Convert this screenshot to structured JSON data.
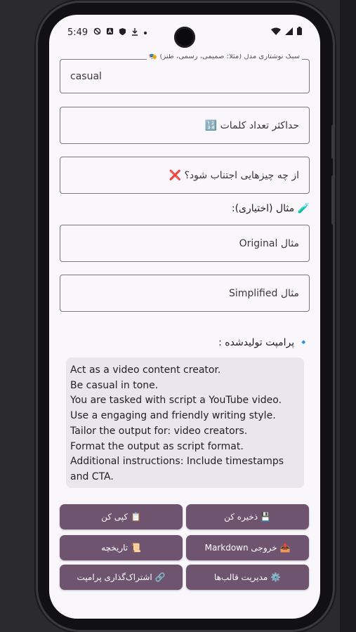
{
  "status_bar": {
    "time": "5:49"
  },
  "form": {
    "tone": {
      "label": "سبک نوشتاری مدل (مثلاً: صمیمی، رسمی، طنز) 🎭",
      "value": "casual"
    },
    "max_words": {
      "placeholder": "حداکثر تعداد کلمات 🔢"
    },
    "avoid": {
      "placeholder": "از چه چیزهایی اجتناب شود؟ ❌"
    },
    "examples_label": "🧪 مثال (اختیاری):",
    "original": {
      "placeholder": "مثال Original"
    },
    "simplified": {
      "placeholder": "مثال Simplified"
    }
  },
  "generated": {
    "label": "🔹 پرامپت تولیدشده :",
    "lines": [
      "Act as a video content creator.",
      "Be casual in tone.",
      "You are tasked with script a YouTube video.",
      "Use a engaging and friendly writing style.",
      "Tailor the output for: video creators.",
      "Format the output as script format.",
      "Additional instructions: Include timestamps",
      "and CTA."
    ]
  },
  "actions": {
    "copy": "📋 کپی کن",
    "save": "💾 ذخیره کن",
    "history": "📜 تاریخچه",
    "export_markdown": "📤 خروجی Markdown",
    "share": "🔗 اشتراک‌گذاری پرامپت",
    "templates": "⚙️ مدیریت قالب‌ها"
  },
  "colors": {
    "button_bg": "#6f5470",
    "screen_bg": "#f9f7fb",
    "prompt_bg": "#ebe6ee"
  },
  "icons": {
    "status_left": [
      "shield-off-icon",
      "a-icon",
      "security-icon",
      "download-icon"
    ],
    "status_right": [
      "wifi-icon",
      "signal-icon",
      "battery-icon"
    ]
  }
}
